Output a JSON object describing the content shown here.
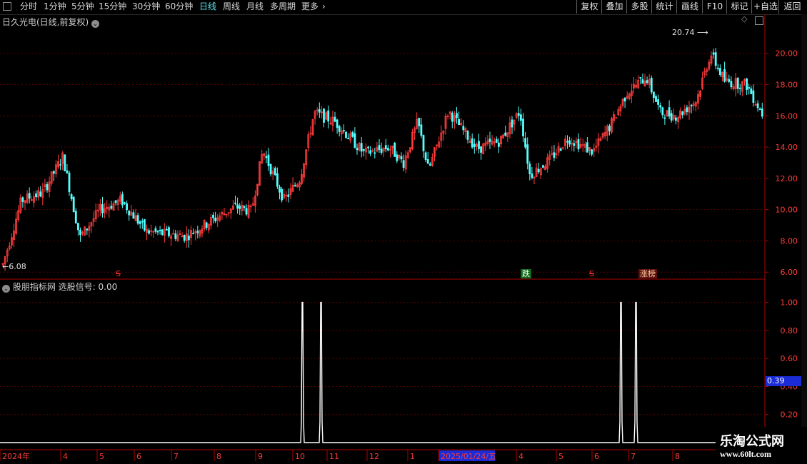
{
  "toolbar": {
    "periods": [
      "分时",
      "1分钟",
      "5分钟",
      "15分钟",
      "30分钟",
      "60分钟",
      "日线",
      "周线",
      "月线",
      "多周期",
      "更多"
    ],
    "active_period": "日线",
    "right_buttons": [
      "复权",
      "叠加",
      "多股",
      "统计",
      "画线",
      "F10",
      "标记",
      "+自选",
      "返回"
    ]
  },
  "main_panel": {
    "title": "日久光电(日线,前复权)",
    "high_label": "20.74",
    "low_label": "6.08",
    "price_ticks": [
      "20.00",
      "18.00",
      "16.00",
      "14.00",
      "12.00",
      "10.00",
      "8.00",
      "6.00"
    ],
    "signals": [
      {
        "text": "S",
        "kind": "sell"
      },
      {
        "text": "跌",
        "kind": "down"
      },
      {
        "text": "S",
        "kind": "sell"
      },
      {
        "text": "涨榜",
        "kind": "up"
      }
    ]
  },
  "indicator_panel": {
    "title": "股朋指标网 选股信号: 0.00",
    "ticks": [
      "1.00",
      "0.80",
      "0.60",
      "0.40",
      "0.20"
    ],
    "current_value": "0.39"
  },
  "date_axis": {
    "labels": [
      "2024年",
      "4",
      "5",
      "6",
      "7",
      "8",
      "9",
      "10",
      "11",
      "12",
      "1",
      "2025/01/24/五",
      "4",
      "5",
      "6",
      "7",
      "8"
    ]
  },
  "watermark": {
    "line1": "乐淘公式网",
    "line2": "www.60lt.com"
  },
  "colors": {
    "up": "#ff3c3c",
    "down": "#54ffff",
    "grid": "#5a0000",
    "axis": "#b00000",
    "active": "#5ee6f0"
  },
  "chart_data": {
    "type": "candlestick",
    "price_ylim": [
      5.6,
      21.4
    ],
    "high": 20.74,
    "low": 6.08,
    "signal_values": [
      1,
      1,
      1,
      1
    ],
    "indicator_ylim": [
      0,
      1.1
    ],
    "current_indicator_value": 0.39
  }
}
